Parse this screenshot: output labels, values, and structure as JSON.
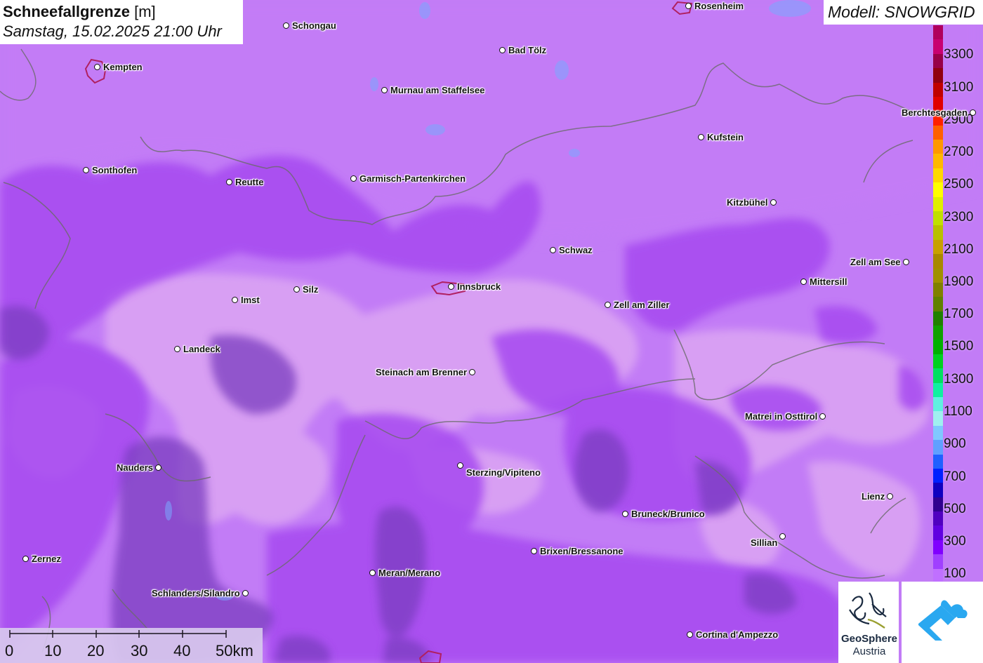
{
  "title": {
    "main": "Schneefallgrenze",
    "unit": "[m]",
    "datetime": "Samstag, 15.02.2025 21:00 Uhr"
  },
  "model": {
    "label": "Modell: SNOWGRID"
  },
  "legend": {
    "labels": [
      "3300",
      "3100",
      "2900",
      "2700",
      "2500",
      "2300",
      "2100",
      "1900",
      "1700",
      "1500",
      "1300",
      "1100",
      "900",
      "700",
      "500",
      "300",
      "100"
    ],
    "colors": [
      "#b0005c",
      "#c80070",
      "#980048",
      "#900010",
      "#c00000",
      "#e00000",
      "#ff2000",
      "#ff6000",
      "#ff9800",
      "#ffb800",
      "#ffd800",
      "#ffff00",
      "#e0f000",
      "#c0e000",
      "#b8c000",
      "#c8a000",
      "#a88800",
      "#a09000",
      "#808000",
      "#608000",
      "#208000",
      "#10a000",
      "#00b000",
      "#00d020",
      "#00e060",
      "#10f0a0",
      "#60f0e0",
      "#a0f0f0",
      "#80c8ff",
      "#60a0ff",
      "#2060ff",
      "#0020ff",
      "#1000c0",
      "#300090",
      "#5000c0",
      "#6000e0",
      "#8000ff",
      "#a040ff",
      "#c070ff"
    ]
  },
  "scale": {
    "ticks": [
      "0",
      "10",
      "20",
      "30",
      "40",
      "50km"
    ]
  },
  "logos": {
    "geosphere_line1": "GeoSphere",
    "geosphere_line2": "Austria"
  },
  "cities": [
    {
      "name": "Rosenheim"
    },
    {
      "name": "Schongau"
    },
    {
      "name": "Kempten"
    },
    {
      "name": "Bad Tölz"
    },
    {
      "name": "Murnau am Staffelsee"
    },
    {
      "name": "Berchtesgaden"
    },
    {
      "name": "Kufstein"
    },
    {
      "name": "Sonthofen"
    },
    {
      "name": "Reutte"
    },
    {
      "name": "Garmisch-Partenkirchen"
    },
    {
      "name": "Kitzbühel"
    },
    {
      "name": "Schwaz"
    },
    {
      "name": "Zell am See"
    },
    {
      "name": "Mittersill"
    },
    {
      "name": "Imst"
    },
    {
      "name": "Silz"
    },
    {
      "name": "Innsbruck"
    },
    {
      "name": "Zell am Ziller"
    },
    {
      "name": "Landeck"
    },
    {
      "name": "Steinach am Brenner"
    },
    {
      "name": "Matrei in Osttirol"
    },
    {
      "name": "Nauders"
    },
    {
      "name": "Sterzing/Vipiteno"
    },
    {
      "name": "Lienz"
    },
    {
      "name": "Bruneck/Brunico"
    },
    {
      "name": "Sillian"
    },
    {
      "name": "Zernez"
    },
    {
      "name": "Brixen/Bressanone"
    },
    {
      "name": "Meran/Merano"
    },
    {
      "name": "Schlanders/Silandro"
    },
    {
      "name": "Cortina d'Ampezzo"
    }
  ]
}
